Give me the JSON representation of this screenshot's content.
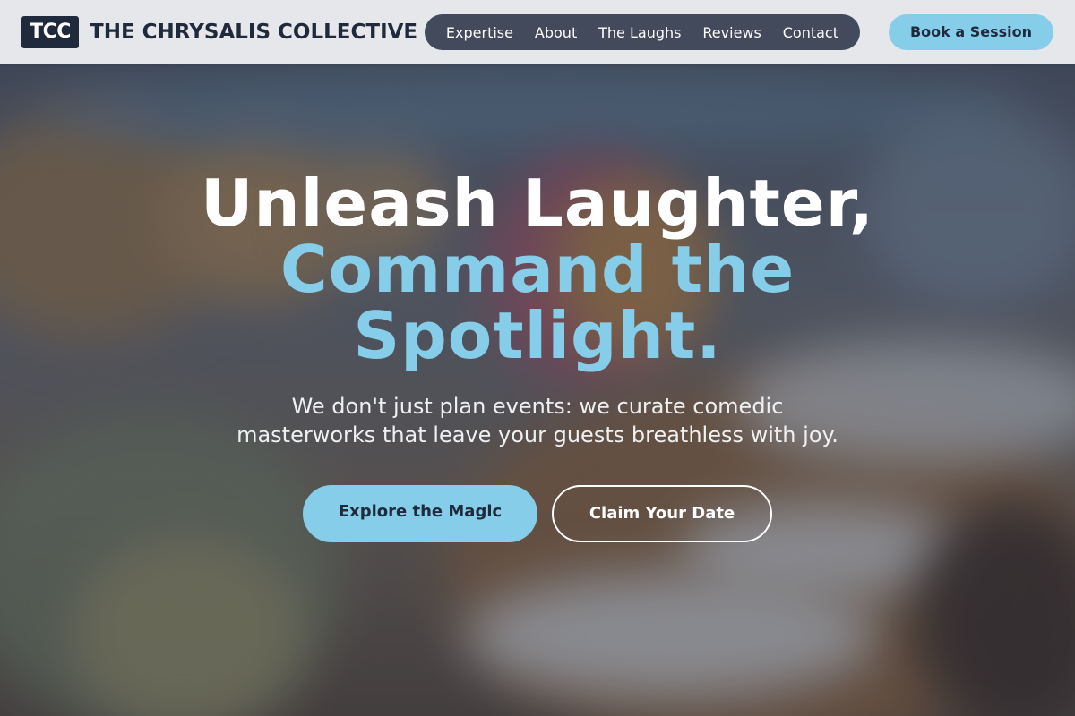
{
  "header": {
    "logo_text": "TCC",
    "brand_name": "THE CHRYSALIS COLLECTIVE",
    "nav": [
      {
        "label": "Expertise"
      },
      {
        "label": "About"
      },
      {
        "label": "The Laughs"
      },
      {
        "label": "Reviews"
      },
      {
        "label": "Contact"
      }
    ],
    "book_button": "Book a Session"
  },
  "hero": {
    "headline_line1": "Unleash Laughter,",
    "headline_line2": "Command the Spotlight.",
    "subhead": "We don't just plan events: we curate comedic masterworks that leave your guests breathless with joy.",
    "primary_cta": "Explore the Magic",
    "secondary_cta": "Claim Your Date",
    "background_image": "blurred-banquet-table-photo"
  },
  "colors": {
    "header_bg": "#e5e7ea",
    "brand_dark": "#1f2a3c",
    "nav_pill_bg": "#434a5b",
    "accent": "#86cde9",
    "white": "#ffffff"
  }
}
